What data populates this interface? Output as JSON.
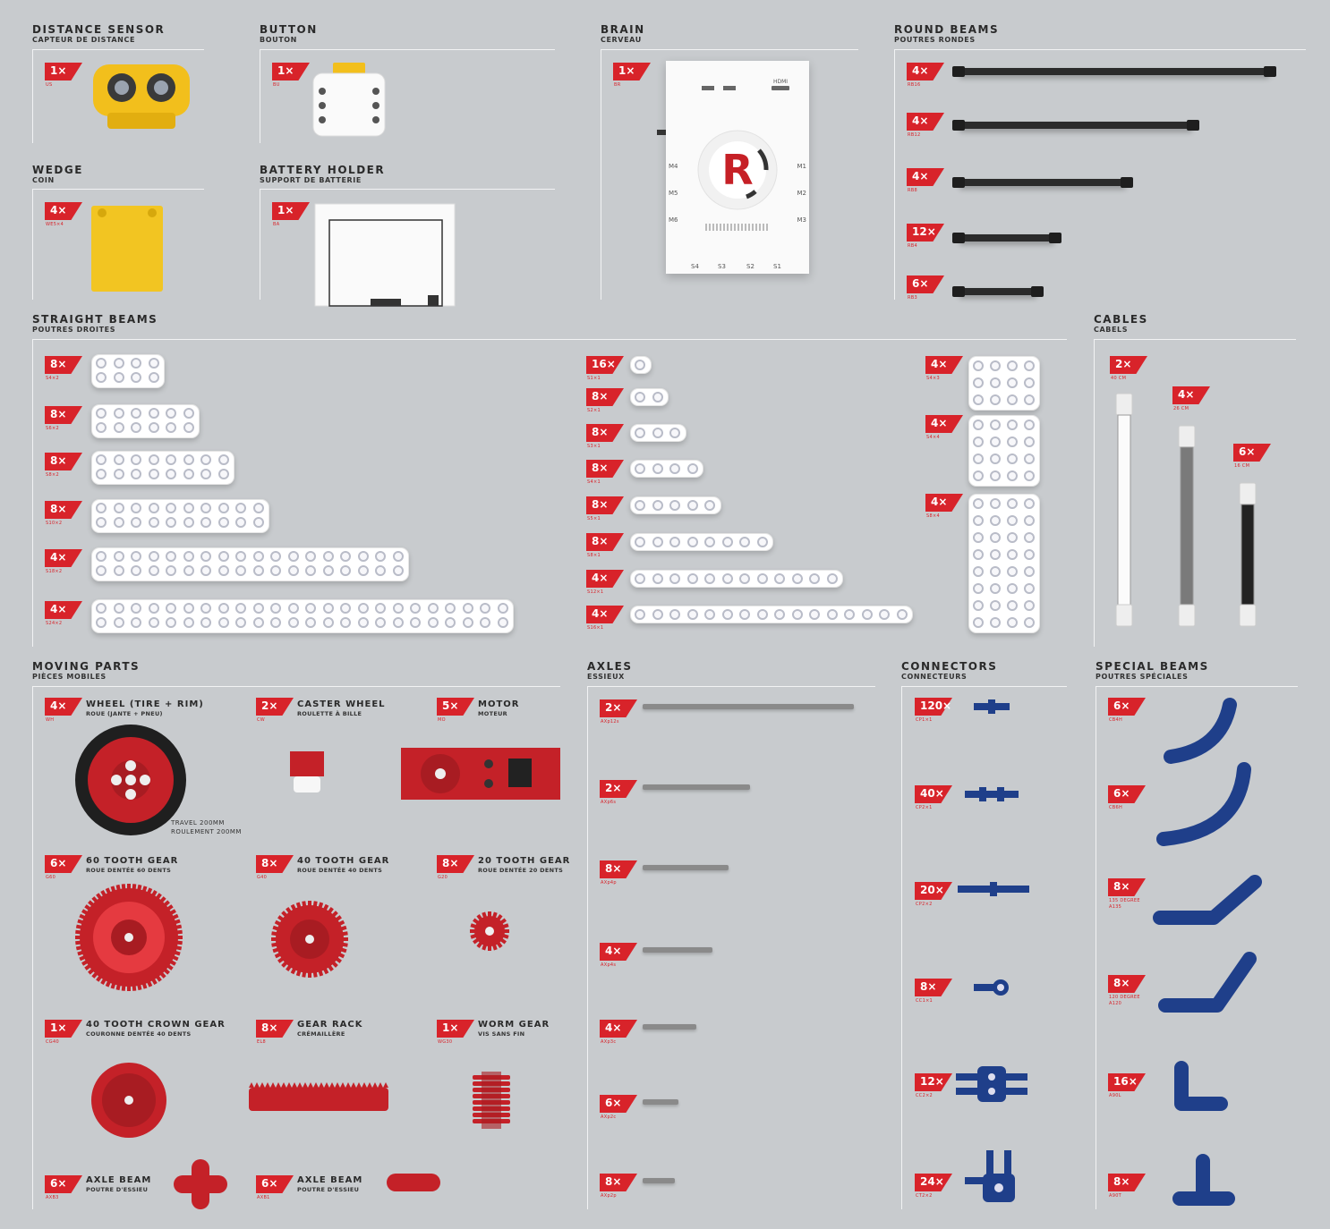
{
  "sections": {
    "distance_sensor": {
      "title": "DISTANCE SENSOR",
      "sub": "CAPTEUR DE DISTANCE",
      "qty": "1×",
      "code": "US"
    },
    "button": {
      "title": "BUTTON",
      "sub": "BOUTON",
      "qty": "1×",
      "code": "BU"
    },
    "brain": {
      "title": "BRAIN",
      "sub": "CERVEAU",
      "qty": "1×",
      "code": "BR",
      "ports_left": [
        "M4",
        "M5",
        "M6"
      ],
      "ports_right": [
        "M1",
        "M2",
        "M3"
      ],
      "ports_bottom": [
        "S4",
        "S3",
        "S2",
        "S1"
      ],
      "hdmi": "HDMI"
    },
    "round_beams": {
      "title": "ROUND BEAMS",
      "sub": "POUTRES RONDES",
      "items": [
        {
          "qty": "4×",
          "code": "RB16"
        },
        {
          "qty": "4×",
          "code": "RB12"
        },
        {
          "qty": "4×",
          "code": "RB8"
        },
        {
          "qty": "12×",
          "code": "RB4"
        },
        {
          "qty": "6×",
          "code": "RB3"
        }
      ]
    },
    "wedge": {
      "title": "WEDGE",
      "sub": "COIN",
      "qty": "4×",
      "code": "WE5×4"
    },
    "battery_holder": {
      "title": "BATTERY HOLDER",
      "sub": "SUPPORT DE BATTERIE",
      "qty": "1×",
      "code": "BA"
    },
    "straight_beams": {
      "title": "STRAIGHT BEAMS",
      "sub": "POUTRES DROITES",
      "double": [
        {
          "qty": "8×",
          "code": "S4×2"
        },
        {
          "qty": "8×",
          "code": "S6×2"
        },
        {
          "qty": "8×",
          "code": "S8×2"
        },
        {
          "qty": "8×",
          "code": "S10×2"
        },
        {
          "qty": "4×",
          "code": "S18×2"
        },
        {
          "qty": "4×",
          "code": "S24×2"
        }
      ],
      "single": [
        {
          "qty": "16×",
          "code": "S1×1"
        },
        {
          "qty": "8×",
          "code": "S2×1"
        },
        {
          "qty": "8×",
          "code": "S3×1"
        },
        {
          "qty": "8×",
          "code": "S4×1"
        },
        {
          "qty": "8×",
          "code": "S5×1"
        },
        {
          "qty": "8×",
          "code": "S8×1"
        },
        {
          "qty": "4×",
          "code": "S12×1"
        },
        {
          "qty": "4×",
          "code": "S16×1"
        }
      ],
      "plates": [
        {
          "qty": "4×",
          "code": "S4×3"
        },
        {
          "qty": "4×",
          "code": "S4×4"
        },
        {
          "qty": "4×",
          "code": "S8×4"
        }
      ]
    },
    "cables": {
      "title": "CABLES",
      "sub": "CABELS",
      "items": [
        {
          "qty": "2×",
          "code": "40 CM"
        },
        {
          "qty": "4×",
          "code": "26 CM"
        },
        {
          "qty": "6×",
          "code": "16 CM"
        }
      ]
    },
    "moving_parts": {
      "title": "MOVING PARTS",
      "sub": "PIÈCES MOBILES",
      "items": [
        {
          "qty": "4×",
          "code": "WH",
          "title": "WHEEL (TIRE + RIM)",
          "sub": "ROUE (JANTE + PNEU)"
        },
        {
          "qty": "2×",
          "code": "CW",
          "title": "CASTER WHEEL",
          "sub": "ROULETTE À BILLE"
        },
        {
          "qty": "5×",
          "code": "MO",
          "title": "MOTOR",
          "sub": "MOTEUR"
        },
        {
          "qty": "6×",
          "code": "G60",
          "title": "60 TOOTH GEAR",
          "sub": "ROUE DENTÉE 60 DENTS"
        },
        {
          "qty": "8×",
          "code": "G40",
          "title": "40 TOOTH GEAR",
          "sub": "ROUE DENTÉE 40 DENTS"
        },
        {
          "qty": "8×",
          "code": "G20",
          "title": "20 TOOTH GEAR",
          "sub": "ROUE DENTÉE 20 DENTS"
        },
        {
          "qty": "1×",
          "code": "CG40",
          "title": "40 TOOTH CROWN GEAR",
          "sub": "COURONNE DENTÉE 40 DENTS"
        },
        {
          "qty": "8×",
          "code": "EL8",
          "title": "GEAR RACK",
          "sub": "CRÉMAILLÈRE"
        },
        {
          "qty": "1×",
          "code": "WG30",
          "title": "WORM GEAR",
          "sub": "VIS SANS FIN"
        },
        {
          "qty": "6×",
          "code": "AXB3",
          "title": "AXLE BEAM",
          "sub": "POUTRE D'ESSIEU"
        },
        {
          "qty": "6×",
          "code": "AXB1",
          "title": "AXLE BEAM",
          "sub": "POUTRE D'ESSIEU"
        }
      ],
      "travel": "TRAVEL 200MM",
      "travel_fr": "ROULEMENT 200MM"
    },
    "axles": {
      "title": "AXLES",
      "sub": "ESSIEUX",
      "items": [
        {
          "qty": "2×",
          "code": "AXp12s"
        },
        {
          "qty": "2×",
          "code": "AXp6s"
        },
        {
          "qty": "8×",
          "code": "AXp4p"
        },
        {
          "qty": "4×",
          "code": "AXp4s"
        },
        {
          "qty": "4×",
          "code": "AXp3c"
        },
        {
          "qty": "6×",
          "code": "AXp2c"
        },
        {
          "qty": "8×",
          "code": "AXp2p"
        }
      ]
    },
    "connectors": {
      "title": "CONNECTORS",
      "sub": "CONNECTEURS",
      "items": [
        {
          "qty": "120×",
          "code": "CP1×1"
        },
        {
          "qty": "40×",
          "code": "CP2×1"
        },
        {
          "qty": "20×",
          "code": "CP2×2"
        },
        {
          "qty": "8×",
          "code": "CC1×1"
        },
        {
          "qty": "12×",
          "code": "CC2×2"
        },
        {
          "qty": "24×",
          "code": "CT2×2"
        }
      ]
    },
    "special_beams": {
      "title": "SPECIAL BEAMS",
      "sub": "POUTRES SPÉCIALES",
      "items": [
        {
          "qty": "6×",
          "code": "CB4H"
        },
        {
          "qty": "6×",
          "code": "CB6H"
        },
        {
          "qty": "8×",
          "code": "135 DEGREE",
          "code2": "A135"
        },
        {
          "qty": "8×",
          "code": "120 DEGREE",
          "code2": "A120"
        },
        {
          "qty": "16×",
          "code": "A90L"
        },
        {
          "qty": "8×",
          "code": "A90T"
        }
      ]
    }
  },
  "colors": {
    "red": "#d8232a",
    "blue": "#1f3f8a",
    "background": "#c8cbce",
    "yellow": "#f0c419"
  }
}
